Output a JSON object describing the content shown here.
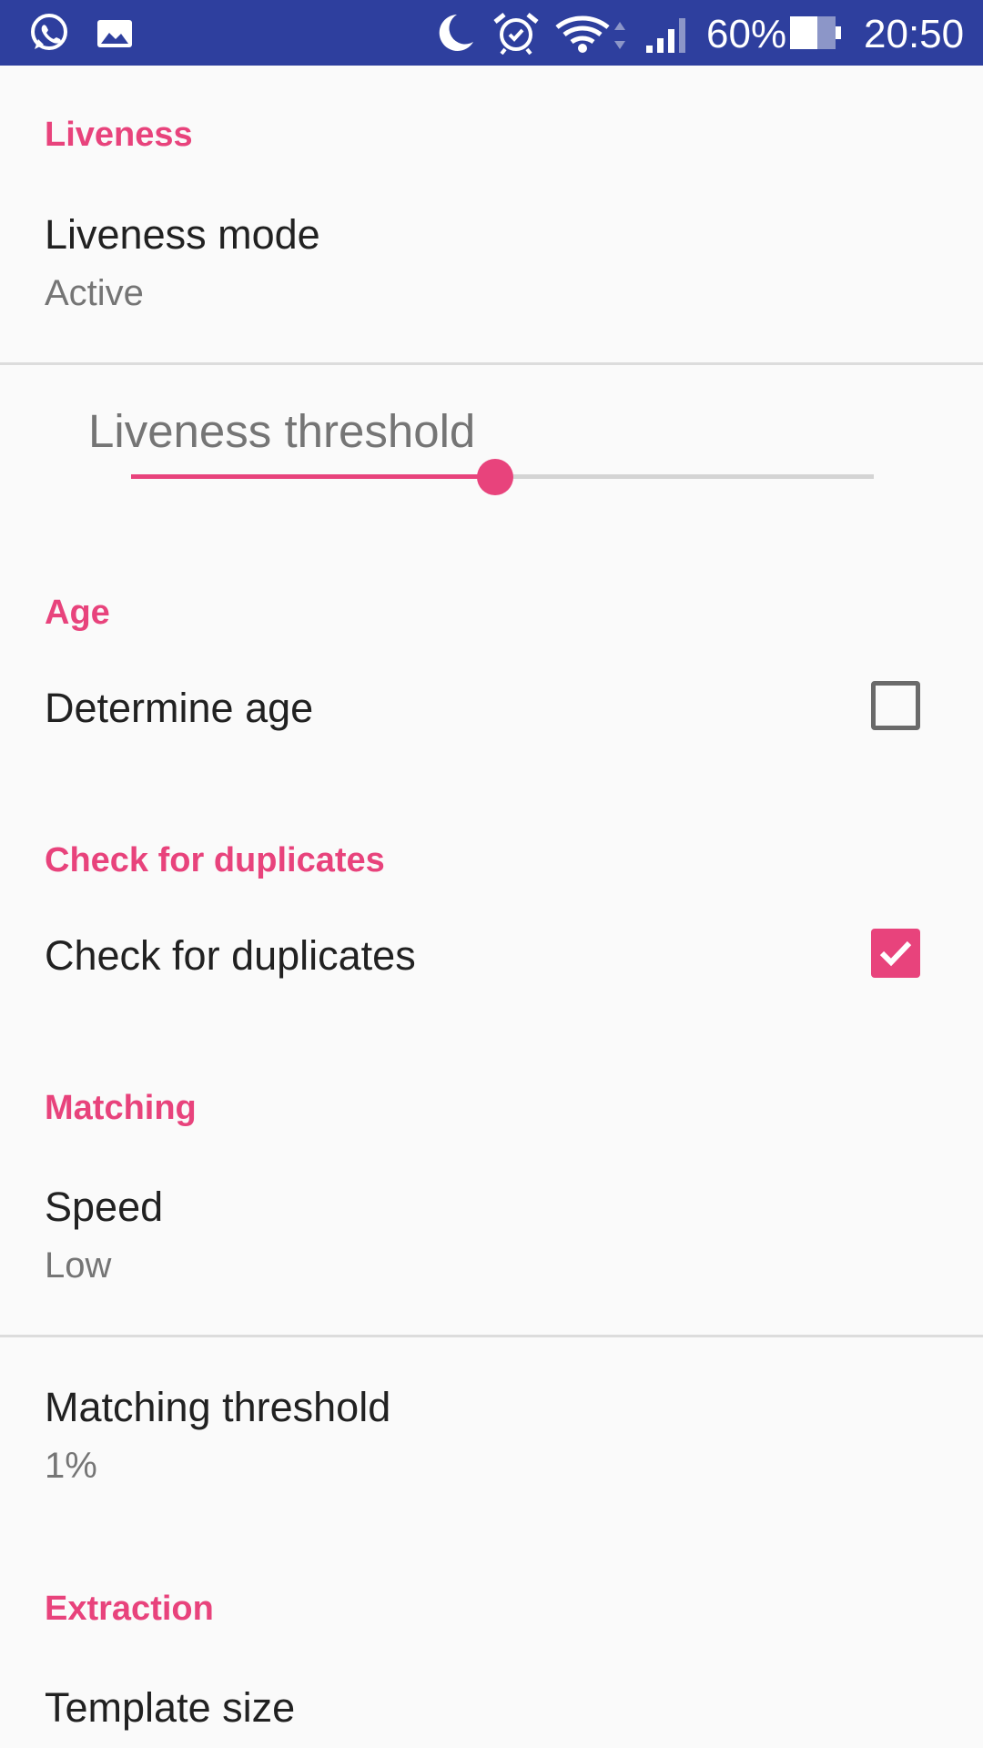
{
  "status_bar": {
    "battery": "60%",
    "time": "20:50",
    "icons": [
      "whatsapp-icon",
      "gallery-icon",
      "do-not-disturb-moon-icon",
      "alarm-icon",
      "wifi-icon",
      "cell-signal-icon",
      "battery-icon"
    ]
  },
  "colors": {
    "status_bar": "#2e3f9e",
    "accent": "#e8437c",
    "background": "#fafafa"
  },
  "sections": {
    "liveness": {
      "header": "Liveness",
      "mode_title": "Liveness mode",
      "mode_value": "Active",
      "threshold_title": "Liveness threshold",
      "threshold_fraction": 0.49
    },
    "age": {
      "header": "Age",
      "determine_age_title": "Determine age",
      "determine_age_checked": false
    },
    "duplicates": {
      "header": "Check for duplicates",
      "check_title": "Check for duplicates",
      "check_checked": true
    },
    "matching": {
      "header": "Matching",
      "speed_title": "Speed",
      "speed_value": "Low",
      "threshold_title": "Matching threshold",
      "threshold_value": "1%"
    },
    "extraction": {
      "header": "Extraction",
      "template_size_title": "Template size"
    }
  }
}
